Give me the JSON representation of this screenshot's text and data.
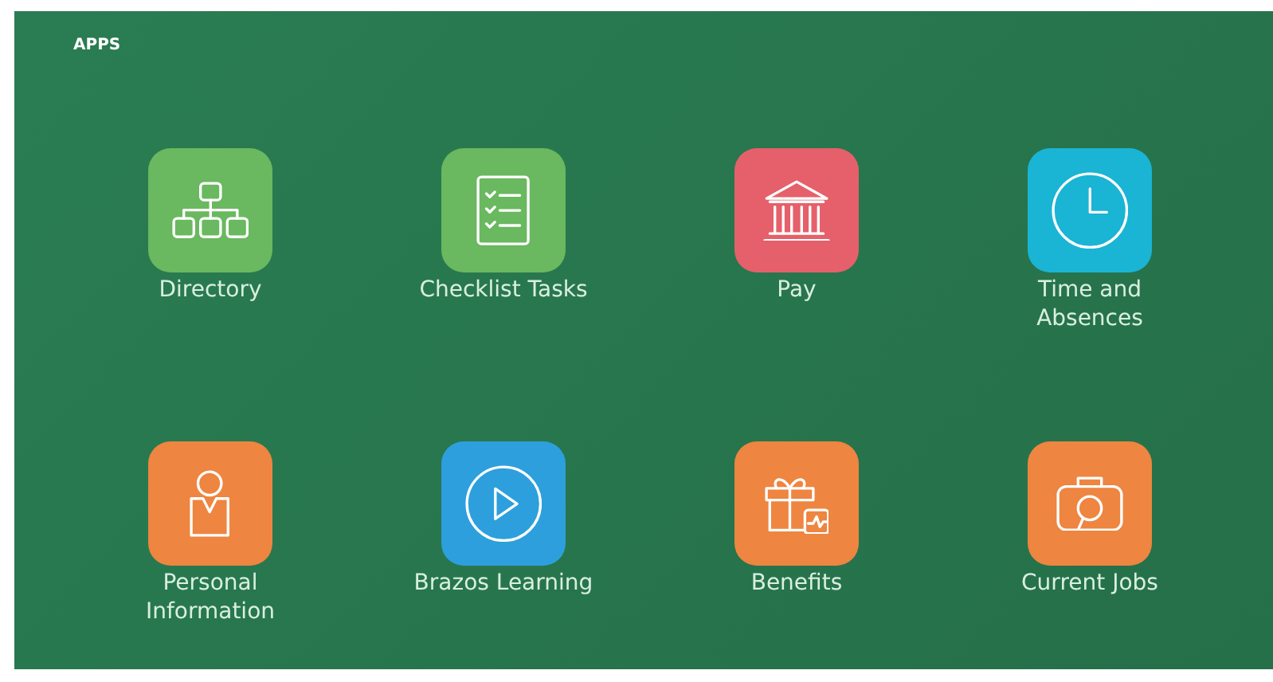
{
  "header": {
    "title": "APPS"
  },
  "apps": [
    {
      "label": "Directory",
      "color": "#6ab85f"
    },
    {
      "label": "Checklist Tasks",
      "color": "#6ab85f"
    },
    {
      "label": "Pay",
      "color": "#e5606a"
    },
    {
      "label": "Time and Absences",
      "color": "#1ab4d4"
    },
    {
      "label": "Personal Information",
      "color": "#ee8540"
    },
    {
      "label": "Brazos Learning",
      "color": "#2d9fdd"
    },
    {
      "label": "Benefits",
      "color": "#ee8540"
    },
    {
      "label": "Current Jobs",
      "color": "#ee8540"
    }
  ]
}
